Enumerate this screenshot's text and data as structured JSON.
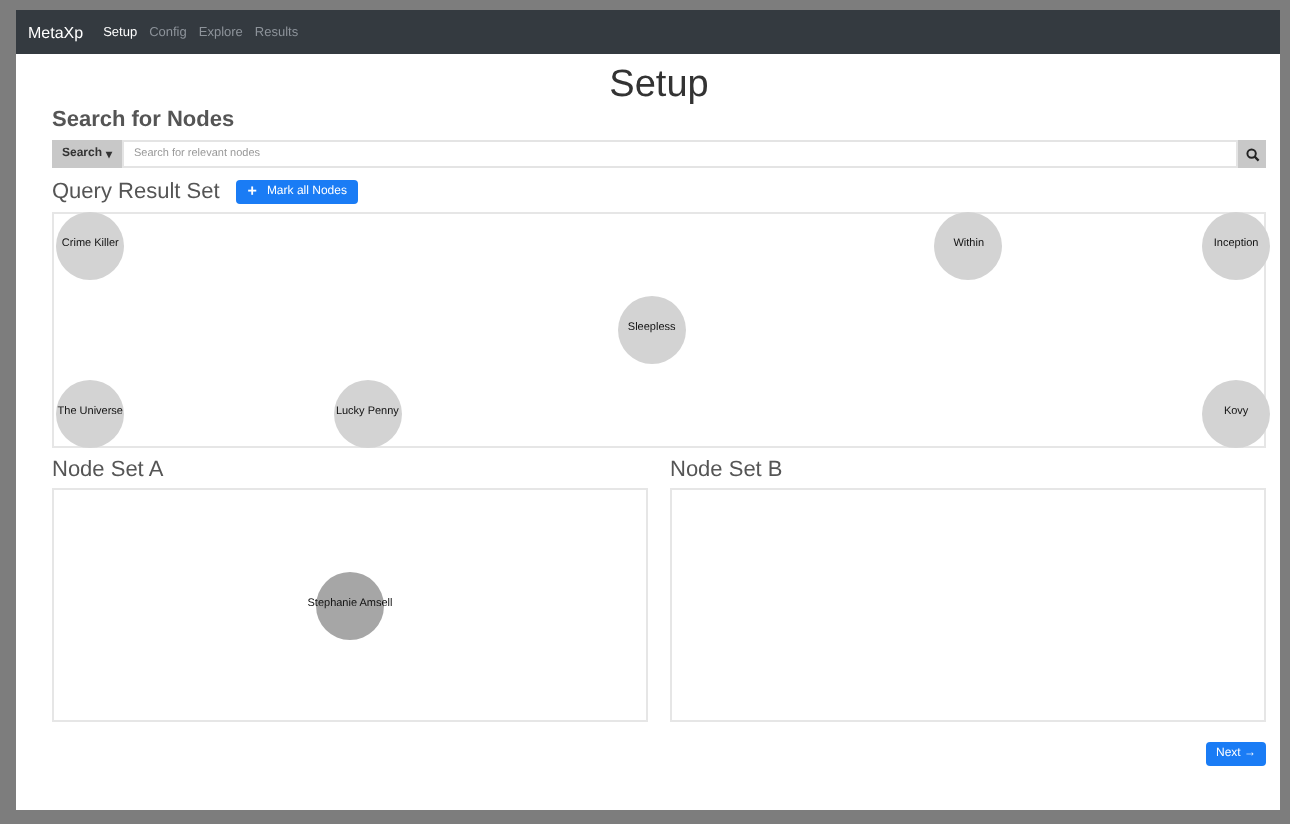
{
  "navbar": {
    "brand": "MetaXp",
    "links": [
      {
        "label": "Setup",
        "selected": true
      },
      {
        "label": "Config",
        "selected": false
      },
      {
        "label": "Explore",
        "selected": false
      },
      {
        "label": "Results",
        "selected": false
      }
    ]
  },
  "title": "Setup",
  "search": {
    "heading": "Search for Nodes",
    "dropdown": "Search",
    "caret": "▾",
    "placeholder": "Search for relevant nodes"
  },
  "query_result": {
    "heading": "Query Result Set",
    "button": "Mark all Nodes",
    "button_icon": "+",
    "nodes": [
      "Crime Killer",
      "Within",
      "Inception",
      "Sleepless",
      "The Universe",
      "Lucky Penny",
      "Kovy"
    ]
  },
  "node_sets": [
    {
      "heading": "Node Set A",
      "nodes": [
        "Stephanie Amsell"
      ]
    },
    {
      "heading": "Node Set B"
    }
  ],
  "next_button": "Next",
  "next_icon": "→"
}
